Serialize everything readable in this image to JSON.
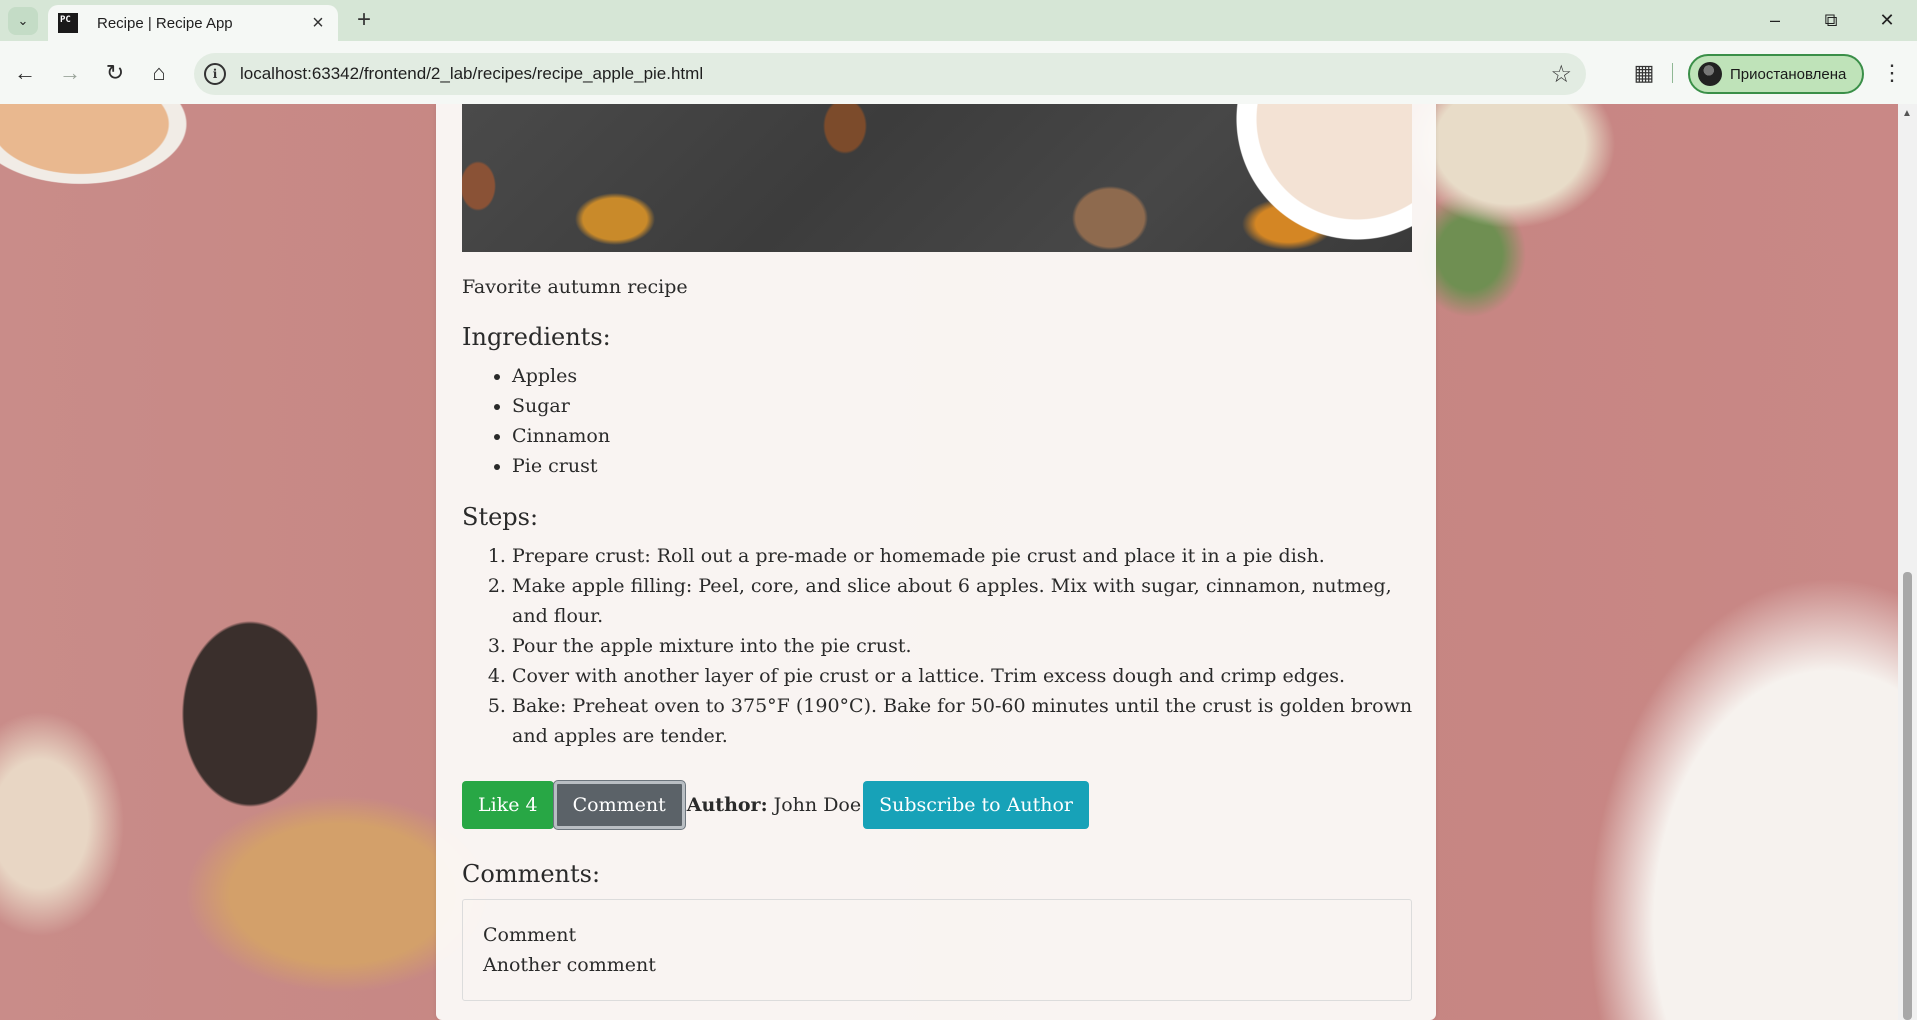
{
  "browser": {
    "tab_title": "Recipe | Recipe App",
    "favicon_text": "PC",
    "url": "localhost:63342/frontend/2_lab/recipes/recipe_apple_pie.html",
    "profile_label": "Приостановлена",
    "accent_color": "#3a8f48"
  },
  "recipe": {
    "tagline": "Favorite autumn recipe",
    "ingredients_heading": "Ingredients:",
    "ingredients": [
      "Apples",
      "Sugar",
      "Cinnamon",
      "Pie crust"
    ],
    "steps_heading": "Steps:",
    "steps": [
      "Prepare crust: Roll out a pre-made or homemade pie crust and place it in a pie dish.",
      "Make apple filling: Peel, core, and slice about 6 apples. Mix with sugar, cinnamon, nutmeg, and flour.",
      "Pour the apple mixture into the pie crust.",
      "Cover with another layer of pie crust or a lattice. Trim excess dough and crimp edges.",
      "Bake: Preheat oven to 375°F (190°C). Bake for 50-60 minutes until the crust is golden brown and apples are tender."
    ]
  },
  "actions": {
    "like_label": "Like 4",
    "comment_label": "Comment",
    "author_label": "Author:",
    "author_name": "John Doe",
    "subscribe_label": "Subscribe to Author",
    "colors": {
      "like": "#28a745",
      "comment": "#6c757d",
      "subscribe": "#17a2b8"
    }
  },
  "comments": {
    "heading": "Comments:",
    "items": [
      "Comment",
      "Another comment"
    ]
  },
  "icons": [
    "tab-search-icon",
    "close-icon",
    "plus-icon",
    "minimize-icon",
    "restore-icon",
    "back-icon",
    "forward-icon",
    "reload-icon",
    "home-icon",
    "info-icon",
    "star-icon",
    "extensions-icon",
    "more-icon"
  ]
}
